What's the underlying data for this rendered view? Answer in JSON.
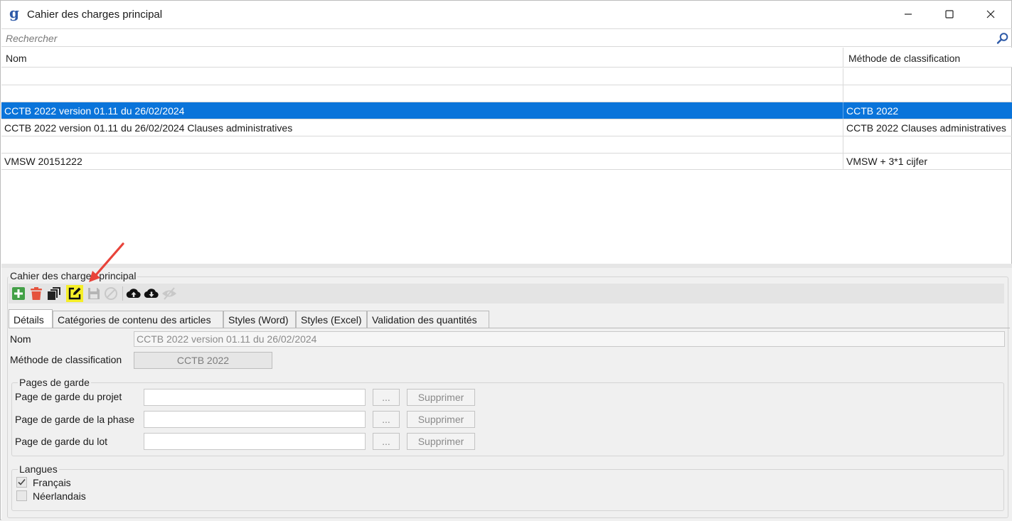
{
  "window": {
    "title": "Cahier des charges principal",
    "logo": "g"
  },
  "search": {
    "placeholder": "Rechercher",
    "value": ""
  },
  "grid": {
    "columns": [
      "Nom",
      "Méthode de classification"
    ],
    "rows": [
      {
        "name": "",
        "method": ""
      },
      {
        "name": "",
        "method": ""
      },
      {
        "name": "CCTB 2022 version 01.11 du 26/02/2024",
        "method": "CCTB 2022",
        "selected": true
      },
      {
        "name": "CCTB 2022 version 01.11 du 26/02/2024 Clauses administratives",
        "method": "CCTB 2022 Clauses administratives"
      },
      {
        "name": "",
        "method": ""
      },
      {
        "name": "VMSW 20151222",
        "method": "VMSW + 3*1 cijfer"
      }
    ]
  },
  "panel": {
    "group_title": "Cahier des charges principal",
    "toolbar": {
      "buttons": [
        "add-icon",
        "delete-icon",
        "copy-icon",
        "edit-icon",
        "save-icon",
        "cancel-icon",
        "upload-icon",
        "download-icon",
        "hide-icon"
      ],
      "highlighted": "edit-icon"
    },
    "tabs": [
      "Détails",
      "Catégories de contenu des articles",
      "Styles (Word)",
      "Styles (Excel)",
      "Validation des quantités"
    ],
    "active_tab": "Détails",
    "details": {
      "name_label": "Nom",
      "name_value": "CCTB 2022 version 01.11 du 26/02/2024",
      "method_label": "Méthode de classification",
      "method_value": "CCTB 2022",
      "cover_pages": {
        "title": "Pages de garde",
        "rows": [
          {
            "label": "Page de garde du projet",
            "value": "",
            "browse": "...",
            "delete": "Supprimer"
          },
          {
            "label": "Page de garde de la phase",
            "value": "",
            "browse": "...",
            "delete": "Supprimer"
          },
          {
            "label": "Page de garde du lot",
            "value": "",
            "browse": "...",
            "delete": "Supprimer"
          }
        ]
      },
      "languages": {
        "title": "Langues",
        "items": [
          {
            "label": "Français",
            "checked": true
          },
          {
            "label": "Néerlandais",
            "checked": false
          }
        ]
      }
    }
  },
  "colors": {
    "selection": "#0a74da",
    "highlight": "#f6ef28",
    "arrow": "#e8433a",
    "add": "#43a047",
    "delete": "#e5533d"
  }
}
